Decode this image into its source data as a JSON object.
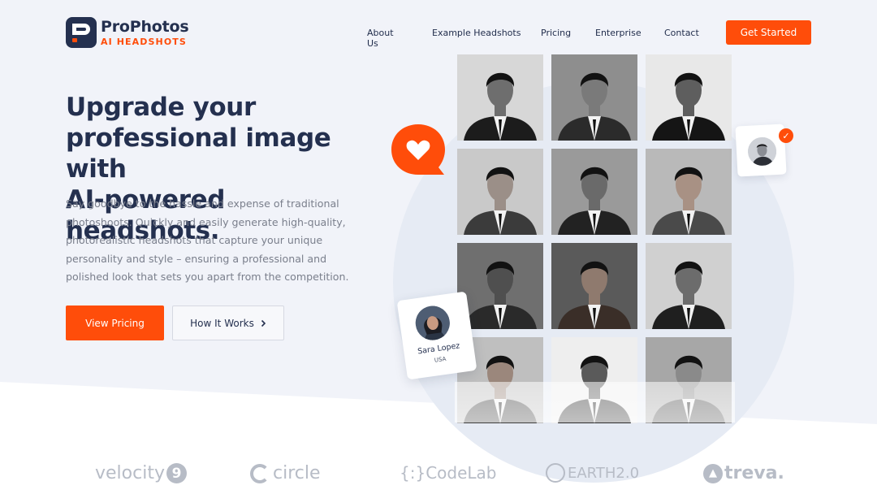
{
  "brand": {
    "title": "ProPhotos",
    "subtitle": "AI HEADSHOTS"
  },
  "nav": {
    "items": [
      "About Us",
      "Example Headshots",
      "Pricing",
      "Enterprise",
      "Contact"
    ],
    "cta": "Get Started"
  },
  "hero": {
    "title_line1": "Upgrade your",
    "title_line2": "professional image with",
    "title_line3": "AI-powered headshots.",
    "description": "Say goodbye to the hassle and expense of traditional photoshoots. Quickly and easily generate high-quality, photorealistic headshots that capture your unique personality and style – ensuring a professional and polished look that sets you apart from the competition.",
    "primary_button": "View Pricing",
    "secondary_button": "How It Works",
    "secondary_icon": "chevron-right-icon"
  },
  "profile_card": {
    "name": "Sara Lopez",
    "location": "USA"
  },
  "brands": {
    "velocity": "velocity",
    "velocity_mark": "9",
    "circle": "circle",
    "codelab_prefix": "{:}",
    "codelab": "CodeLab",
    "earth": "EARTH2.0",
    "treva": "treva."
  },
  "colors": {
    "accent": "#ff4d0a",
    "navy": "#24304f",
    "hero_bg": "#f1f3f9",
    "brand_gray": "#b7bcc6"
  }
}
